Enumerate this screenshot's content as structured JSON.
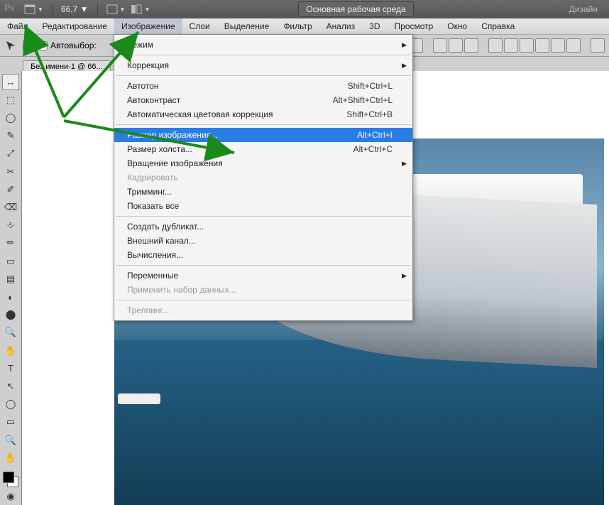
{
  "top": {
    "logo": "Ps",
    "zoom": "66,7",
    "workspace_primary": "Основная рабочая среда",
    "workspace_secondary": "Дизайн"
  },
  "menu": {
    "items": [
      "Файл",
      "Редактирование",
      "Изображение",
      "Слои",
      "Выделение",
      "Фильтр",
      "Анализ",
      "3D",
      "Просмотр",
      "Окно",
      "Справка"
    ],
    "active_index": 2
  },
  "options": {
    "auto_select_label": "Автовыбор:"
  },
  "tab": {
    "title": "Без имени-1 @ 66..."
  },
  "tools": [
    "↔",
    "⬚",
    "◯",
    "✎",
    "⤢",
    "✂",
    "✐",
    "⌫",
    "⎀",
    "✏",
    "▭",
    "▤",
    "◐",
    "⬤",
    "🔍",
    "✋",
    "T",
    "↖",
    "◯",
    "▭",
    "🔍",
    "✋"
  ],
  "dropdown": {
    "groups": [
      [
        {
          "label": "Режим",
          "sub": true
        }
      ],
      [
        {
          "label": "Коррекция",
          "sub": true
        }
      ],
      [
        {
          "label": "Автотон",
          "shortcut": "Shift+Ctrl+L"
        },
        {
          "label": "Автоконтраст",
          "shortcut": "Alt+Shift+Ctrl+L"
        },
        {
          "label": "Автоматическая цветовая коррекция",
          "shortcut": "Shift+Ctrl+B"
        }
      ],
      [
        {
          "label": "Размер изображения...",
          "shortcut": "Alt+Ctrl+I",
          "hi": true
        },
        {
          "label": "Размер холста...",
          "shortcut": "Alt+Ctrl+C"
        },
        {
          "label": "Вращение изображения",
          "sub": true
        },
        {
          "label": "Кадрировать",
          "disabled": true
        },
        {
          "label": "Тримминг..."
        },
        {
          "label": "Показать все"
        }
      ],
      [
        {
          "label": "Создать дубликат..."
        },
        {
          "label": "Внешний канал..."
        },
        {
          "label": "Вычисления..."
        }
      ],
      [
        {
          "label": "Переменные",
          "sub": true
        },
        {
          "label": "Применить набор данных...",
          "disabled": true
        }
      ],
      [
        {
          "label": "Треппинг...",
          "disabled": true
        }
      ]
    ]
  }
}
